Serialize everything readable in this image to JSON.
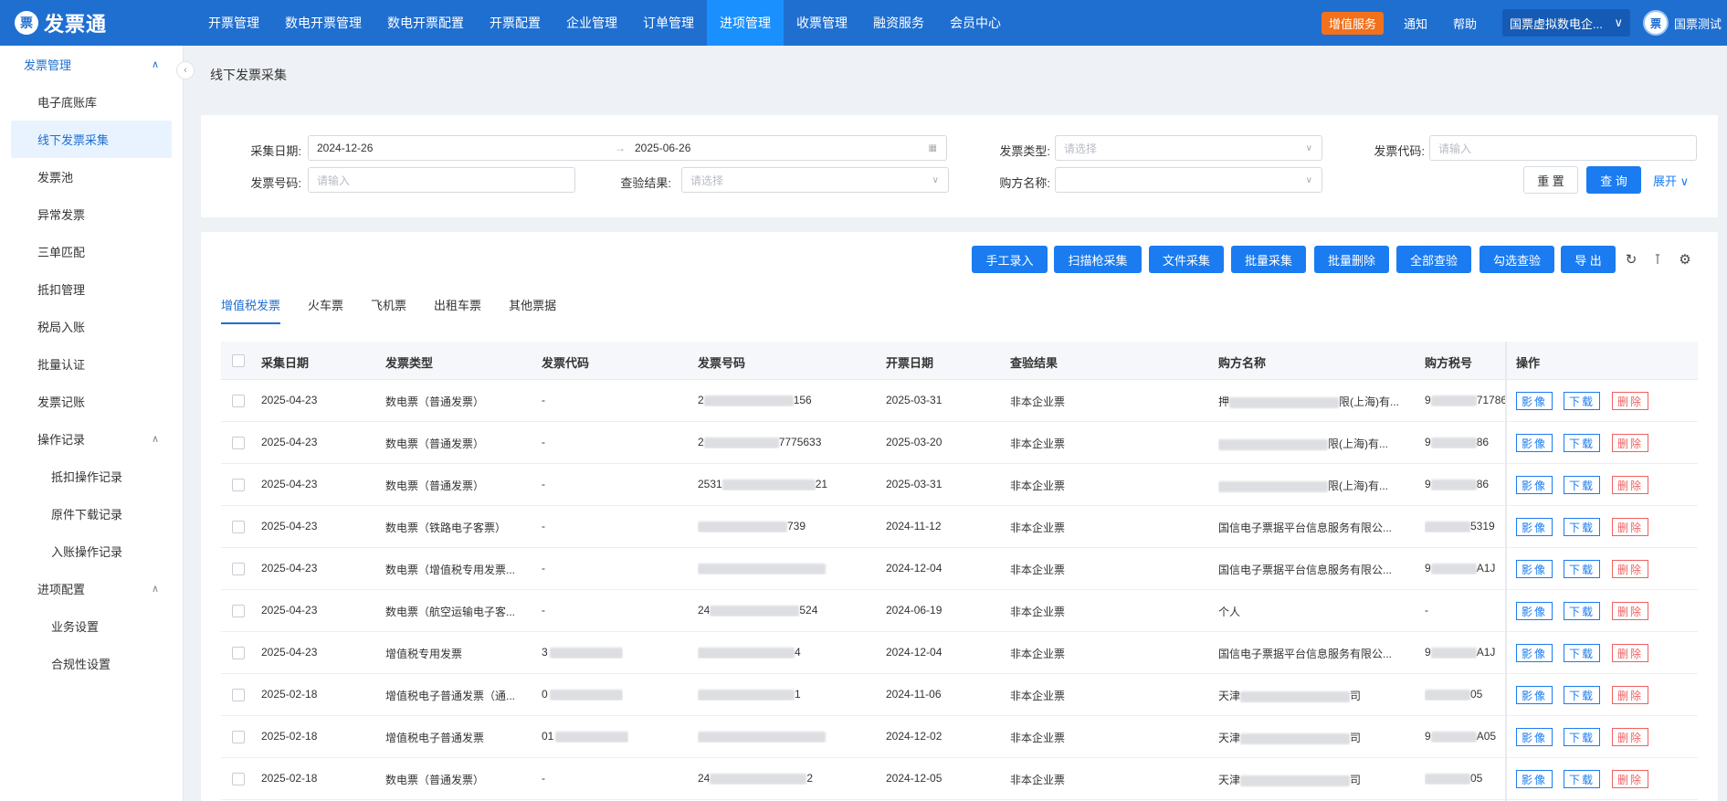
{
  "topbar": {
    "logo_mark": "票",
    "logo_text": "发票通",
    "nav": [
      "开票管理",
      "数电开票管理",
      "数电开票配置",
      "开票配置",
      "企业管理",
      "订单管理",
      "进项管理",
      "收票管理",
      "融资服务",
      "会员中心"
    ],
    "active_nav": "进项管理",
    "vas": "增值服务",
    "notify": "通知",
    "help": "帮助",
    "company": "国票虚拟数电企...",
    "avatar": "票",
    "user": "国票测试"
  },
  "sidebar": {
    "group_invoice": "发票管理",
    "items": [
      "电子底账库",
      "线下发票采集",
      "发票池",
      "异常发票",
      "三单匹配",
      "抵扣管理",
      "税局入账",
      "批量认证",
      "发票记账"
    ],
    "active_item": "线下发票采集",
    "group_ops": "操作记录",
    "ops_items": [
      "抵扣操作记录",
      "原件下载记录",
      "入账操作记录"
    ],
    "group_cfg": "进项配置",
    "cfg_items": [
      "业务设置",
      "合规性设置"
    ]
  },
  "breadcrumb": "线下发票采集",
  "filters": {
    "date_label": "采集日期:",
    "date_start": "2024-12-26",
    "date_end": "2025-06-26",
    "type_label": "发票类型:",
    "type_placeholder": "请选择",
    "code_label": "发票代码:",
    "code_placeholder": "请输入",
    "number_label": "发票号码:",
    "number_placeholder": "请输入",
    "check_label": "查验结果:",
    "check_placeholder": "请选择",
    "buyer_label": "购方名称:",
    "reset": "重 置",
    "query": "查 询",
    "expand": "展开 ∨"
  },
  "toolbar": [
    "手工录入",
    "扫描枪采集",
    "文件采集",
    "批量采集",
    "批量删除",
    "全部查验",
    "勾选查验",
    "导 出"
  ],
  "tabs": [
    "增值税发票",
    "火车票",
    "飞机票",
    "出租车票",
    "其他票据"
  ],
  "columns": [
    "采集日期",
    "发票类型",
    "发票代码",
    "发票号码",
    "开票日期",
    "查验结果",
    "购方名称",
    "购方税号",
    "操作"
  ],
  "ops": [
    "影像",
    "下载",
    "删除"
  ],
  "rows": [
    {
      "collect": "2025-04-23",
      "type": "数电票（普通发票）",
      "code": "-",
      "num_a": "2",
      "num_b": "156",
      "date": "2025-03-31",
      "result": "非本企业票",
      "buyer_a": "押",
      "buyer_b": "限(上海)有...",
      "tax_a": "9",
      "tax_b": "71786"
    },
    {
      "collect": "2025-04-23",
      "type": "数电票（普通发票）",
      "code": "-",
      "num_a": "2",
      "num_b": "7775633",
      "date": "2025-03-20",
      "result": "非本企业票",
      "buyer_a": "",
      "buyer_b": "限(上海)有...",
      "tax_a": "9",
      "tax_b": "86"
    },
    {
      "collect": "2025-04-23",
      "type": "数电票（普通发票）",
      "code": "-",
      "num_a": "2531",
      "num_b": "21",
      "date": "2025-03-31",
      "result": "非本企业票",
      "buyer_a": "",
      "buyer_b": "限(上海)有...",
      "tax_a": "9",
      "tax_b": "86"
    },
    {
      "collect": "2025-04-23",
      "type": "数电票（铁路电子客票）",
      "code": "-",
      "num_a": "",
      "num_b": "739",
      "date": "2024-11-12",
      "result": "非本企业票",
      "buyer_a": "国信电子票据平台信息服务有限公...",
      "buyer_b": "",
      "tax_a": "",
      "tax_b": "5319"
    },
    {
      "collect": "2025-04-23",
      "type": "数电票（增值税专用发票...",
      "code": "-",
      "num_a": "",
      "num_b": "",
      "date": "2024-12-04",
      "result": "非本企业票",
      "buyer_a": "国信电子票据平台信息服务有限公...",
      "buyer_b": "",
      "tax_a": "9",
      "tax_b": "A1J"
    },
    {
      "collect": "2025-04-23",
      "type": "数电票（航空运输电子客...",
      "code": "-",
      "num_a": "24",
      "num_b": "524",
      "date": "2024-06-19",
      "result": "非本企业票",
      "buyer_a": "个人",
      "buyer_b": "",
      "tax_a": "-",
      "tax_b": ""
    },
    {
      "collect": "2025-04-23",
      "type": "增值税专用发票",
      "code": "3",
      "num_a": "",
      "num_b": "4",
      "date": "2024-12-04",
      "result": "非本企业票",
      "buyer_a": "国信电子票据平台信息服务有限公...",
      "buyer_b": "",
      "tax_a": "9",
      "tax_b": "A1J"
    },
    {
      "collect": "2025-02-18",
      "type": "增值税电子普通发票（通...",
      "code": "0",
      "num_a": "",
      "num_b": "1",
      "date": "2024-11-06",
      "result": "非本企业票",
      "buyer_a": "天津",
      "buyer_b": "司",
      "tax_a": "",
      "tax_b": "05"
    },
    {
      "collect": "2025-02-18",
      "type": "增值税电子普通发票",
      "code": "01",
      "num_a": "",
      "num_b": "",
      "date": "2024-12-02",
      "result": "非本企业票",
      "buyer_a": "天津",
      "buyer_b": "司",
      "tax_a": "9",
      "tax_b": "A05"
    },
    {
      "collect": "2025-02-18",
      "type": "数电票（普通发票）",
      "code": "-",
      "num_a": "24",
      "num_b": "2",
      "date": "2024-12-05",
      "result": "非本企业票",
      "buyer_a": "天津",
      "buyer_b": "司",
      "tax_a": "",
      "tax_b": "05"
    }
  ]
}
